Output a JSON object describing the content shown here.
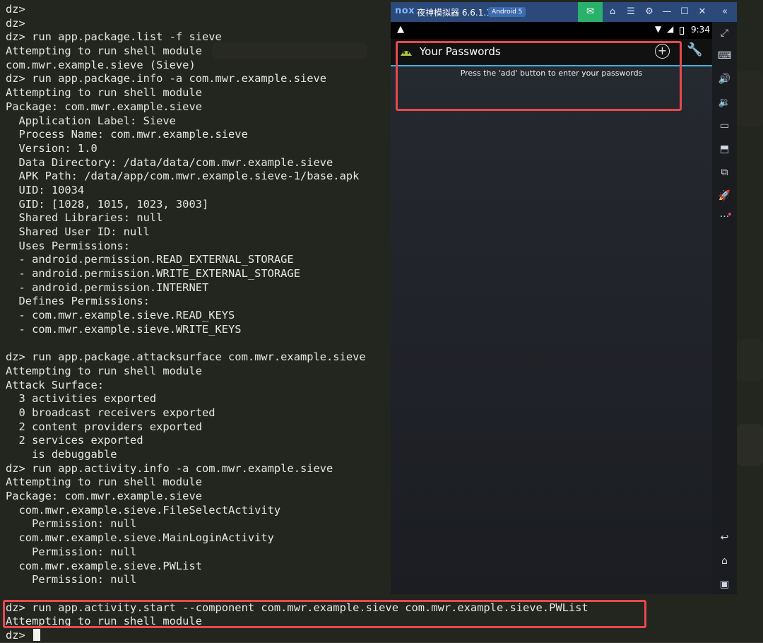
{
  "terminal": {
    "lines": [
      "dz>",
      "dz>",
      "dz> run app.package.list -f sieve",
      "Attempting to run shell module",
      "com.mwr.example.sieve (Sieve)",
      "dz> run app.package.info -a com.mwr.example.sieve",
      "Attempting to run shell module",
      "Package: com.mwr.example.sieve",
      "  Application Label: Sieve",
      "  Process Name: com.mwr.example.sieve",
      "  Version: 1.0",
      "  Data Directory: /data/data/com.mwr.example.sieve",
      "  APK Path: /data/app/com.mwr.example.sieve-1/base.apk",
      "  UID: 10034",
      "  GID: [1028, 1015, 1023, 3003]",
      "  Shared Libraries: null",
      "  Shared User ID: null",
      "  Uses Permissions:",
      "  - android.permission.READ_EXTERNAL_STORAGE",
      "  - android.permission.WRITE_EXTERNAL_STORAGE",
      "  - android.permission.INTERNET",
      "  Defines Permissions:",
      "  - com.mwr.example.sieve.READ_KEYS",
      "  - com.mwr.example.sieve.WRITE_KEYS",
      "",
      "dz> run app.package.attacksurface com.mwr.example.sieve",
      "Attempting to run shell module",
      "Attack Surface:",
      "  3 activities exported",
      "  0 broadcast receivers exported",
      "  2 content providers exported",
      "  2 services exported",
      "    is debuggable",
      "dz> run app.activity.info -a com.mwr.example.sieve",
      "Attempting to run shell module",
      "Package: com.mwr.example.sieve",
      "  com.mwr.example.sieve.FileSelectActivity",
      "    Permission: null",
      "  com.mwr.example.sieve.MainLoginActivity",
      "    Permission: null",
      "  com.mwr.example.sieve.PWList",
      "    Permission: null",
      "",
      "dz> run app.activity.start --component com.mwr.example.sieve com.mwr.example.sieve.PWList",
      "Attempting to run shell module",
      "dz> "
    ]
  },
  "emulator": {
    "logo": "nox",
    "title": "夜神模拟器 6.6.1.1",
    "android_badge": "Android 5",
    "titlebar_icons": [
      "message-icon",
      "shirt-icon",
      "menu-icon",
      "gear-icon",
      "minimize-icon",
      "maximize-icon",
      "close-icon",
      "collapse-icon"
    ],
    "status_bar": {
      "warning_glyph": "▲",
      "time": "9:34"
    },
    "app": {
      "title": "Your Passwords",
      "add_glyph": "+",
      "empty_message": "Press the 'add' button to enter your passwords"
    },
    "sidebar_icons": [
      "fullscreen-icon",
      "keyboard-icon",
      "volume-up-icon",
      "volume-down-icon",
      "screen-icon",
      "apk-install-icon",
      "multi-instance-icon",
      "rocket-icon",
      "more-icon",
      "back-icon",
      "home-icon",
      "recents-icon"
    ]
  },
  "colors": {
    "highlight": "#e8484e",
    "titlebar": "#2b4a7a",
    "accent_line": "#33b5e5"
  }
}
